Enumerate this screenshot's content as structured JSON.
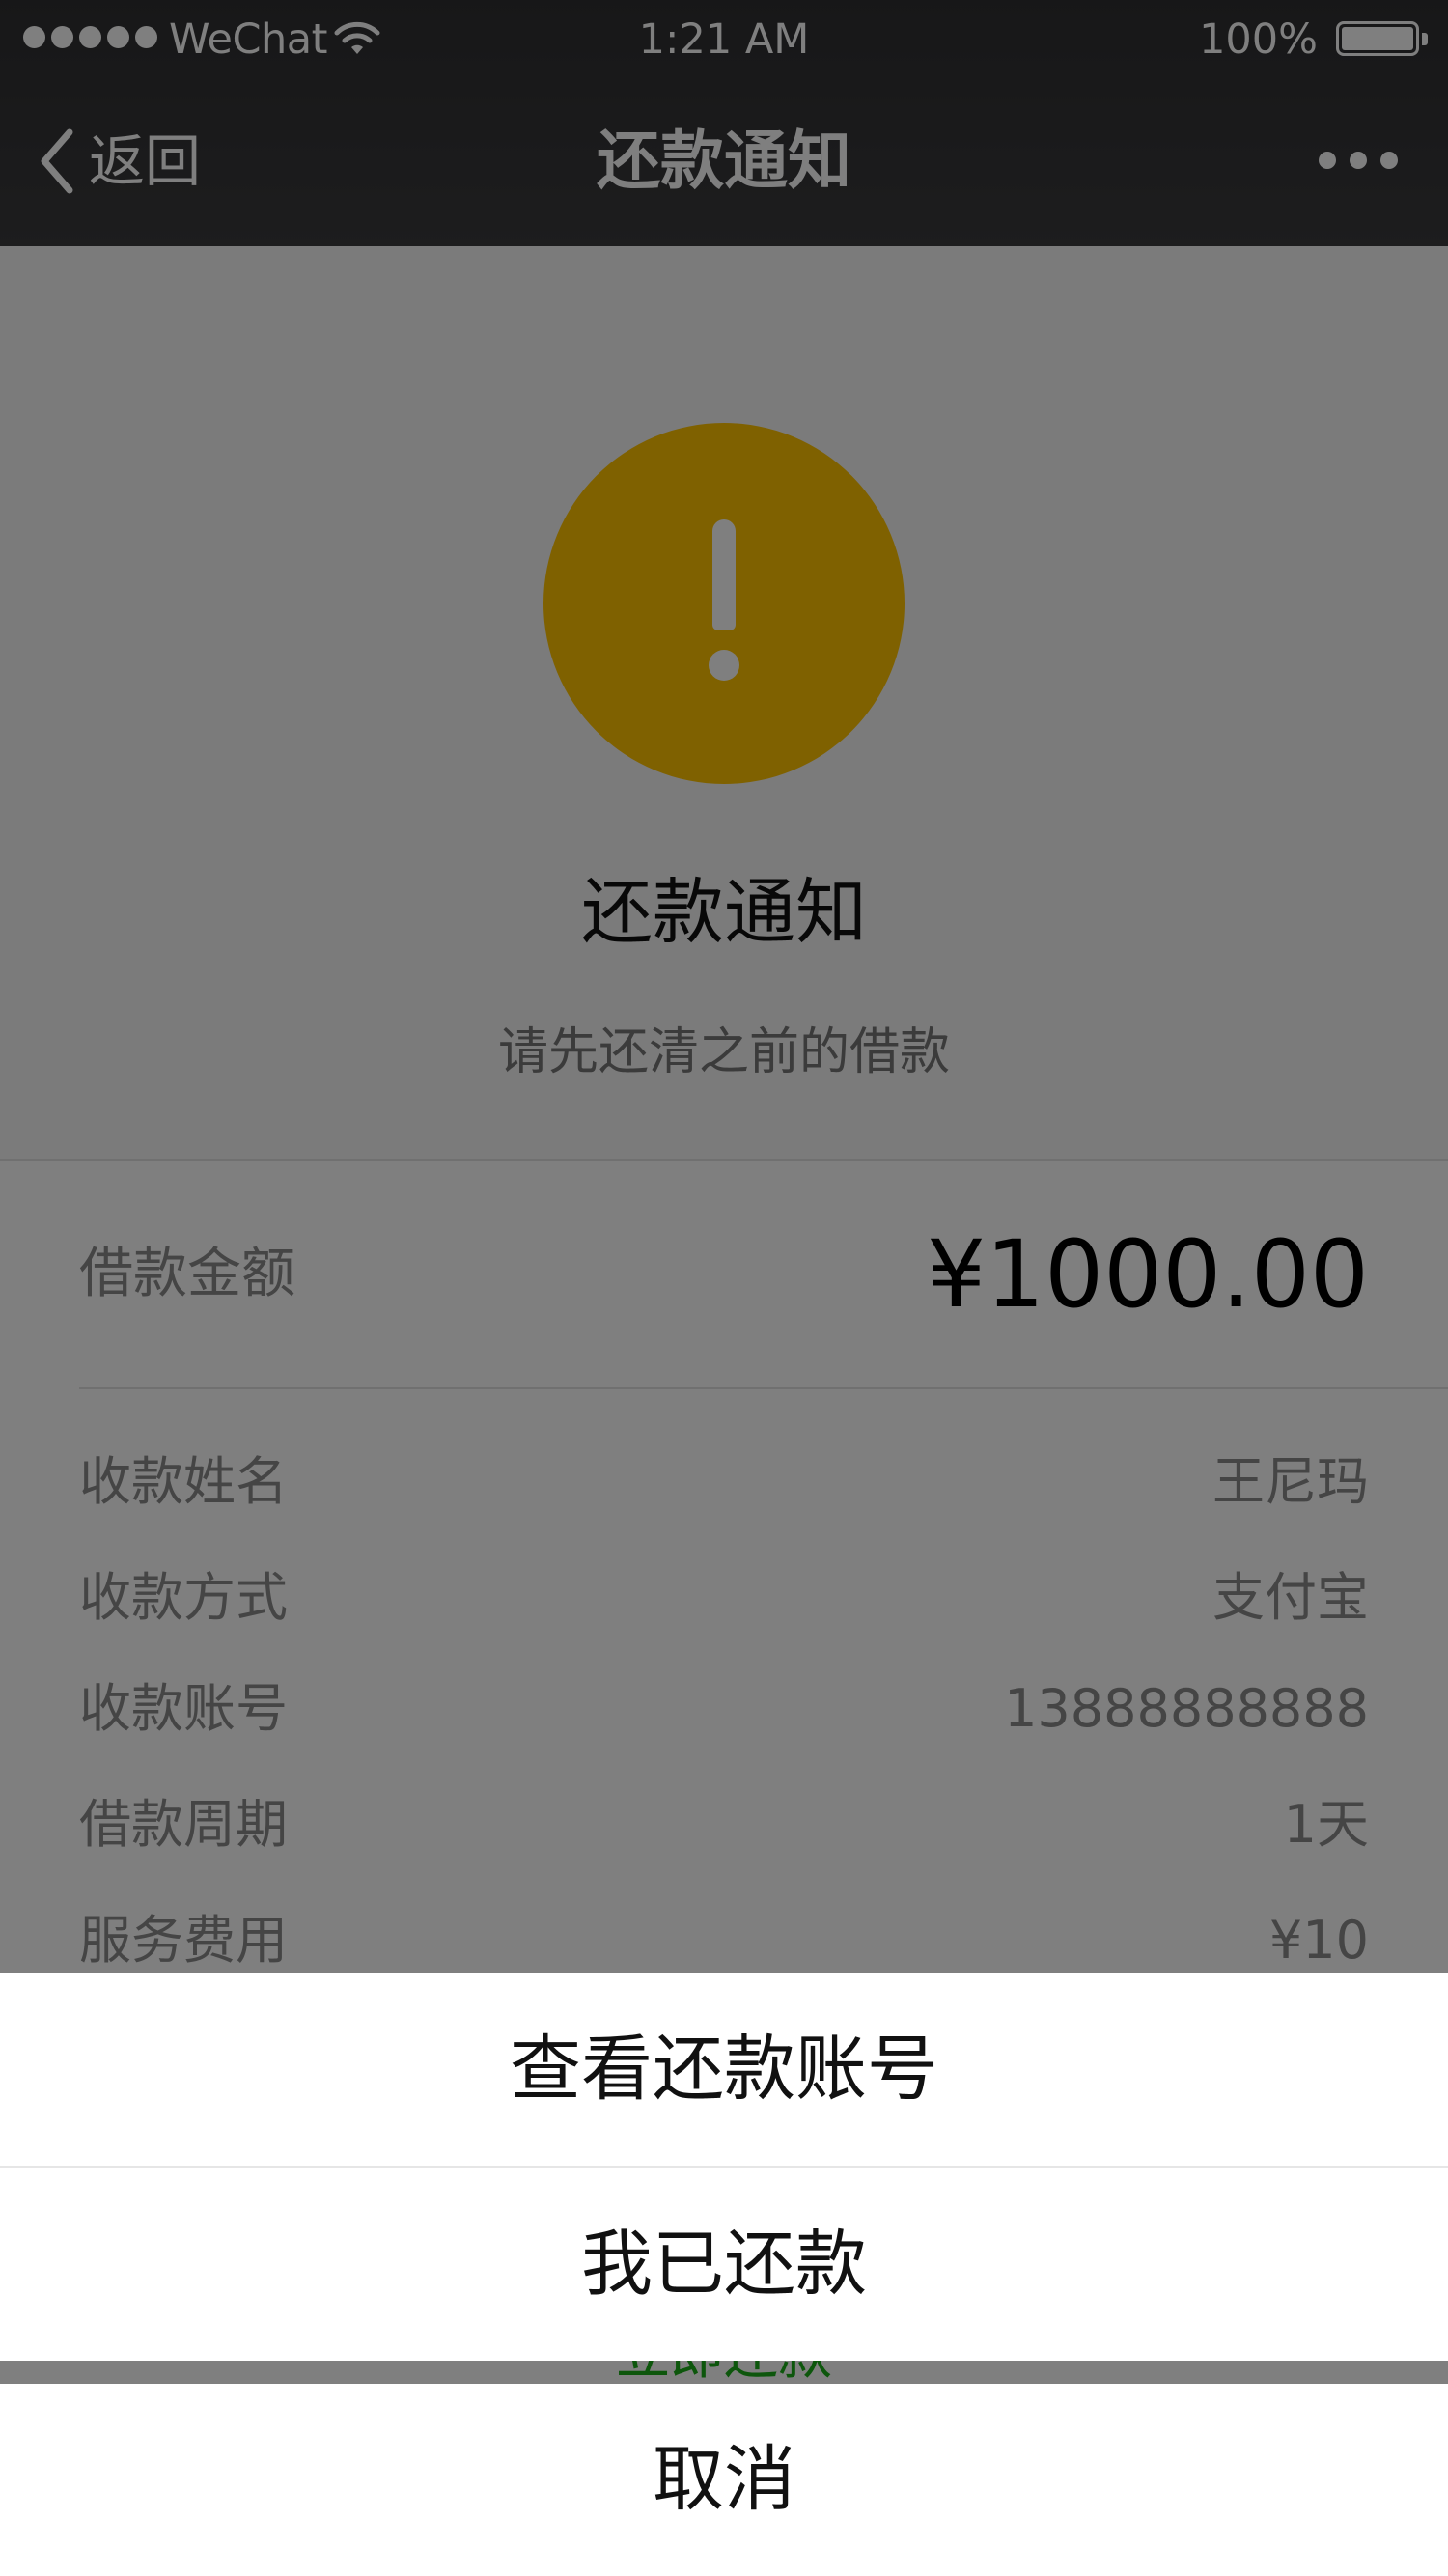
{
  "status_bar": {
    "carrier": "WeChat",
    "time": "1:21 AM",
    "battery": "100%"
  },
  "nav": {
    "back_label": "返回",
    "title": "还款通知"
  },
  "hero": {
    "title": "还款通知",
    "description": "请先还清之前的借款",
    "icon": "warning-icon",
    "icon_color": "#ffc200"
  },
  "loan": {
    "amount_label": "借款金额",
    "amount_value": "¥1000.00",
    "details": [
      {
        "label": "收款姓名",
        "value": "王尼玛"
      },
      {
        "label": "收款方式",
        "value": "支付宝"
      },
      {
        "label": "收款账号",
        "value": "13888888888"
      },
      {
        "label": "借款周期",
        "value": "1天"
      },
      {
        "label": "服务费用",
        "value": "¥10"
      }
    ],
    "repay_link": "立即还款",
    "link_color": "#1aad19"
  },
  "action_sheet": {
    "items": [
      "查看还款账号",
      "我已还款"
    ],
    "cancel": "取消"
  }
}
